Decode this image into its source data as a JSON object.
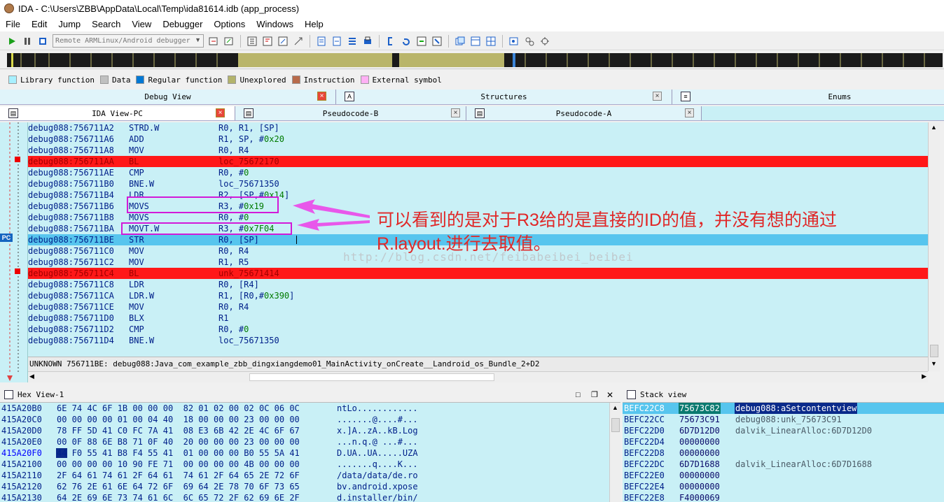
{
  "window": {
    "title": "IDA - C:\\Users\\ZBB\\AppData\\Local\\Temp\\ida81614.idb (app_process)"
  },
  "menu": [
    "File",
    "Edit",
    "Jump",
    "Search",
    "View",
    "Debugger",
    "Options",
    "Windows",
    "Help"
  ],
  "toolbar": {
    "debugger_select": "Remote ARMLinux/Android debugger"
  },
  "legend": [
    {
      "label": "Library function",
      "color": "#a8f0ff"
    },
    {
      "label": "Data",
      "color": "#c0c0c0"
    },
    {
      "label": "Regular function",
      "color": "#0078d4"
    },
    {
      "label": "Unexplored",
      "color": "#b3b36b"
    },
    {
      "label": "Instruction",
      "color": "#b86a4a"
    },
    {
      "label": "External symbol",
      "color": "#ffb0f4"
    }
  ],
  "tabs_top": [
    "Debug View",
    "Structures",
    "Enums"
  ],
  "tabs_sub": [
    "IDA View-PC",
    "Pseudocode-B",
    "Pseudocode-A"
  ],
  "gutter": {
    "pc_label": "PC"
  },
  "code": [
    {
      "addr": "debug088:756711A2",
      "mn": "STRD.W",
      "op": "R0, R1, [SP]"
    },
    {
      "addr": "debug088:756711A6",
      "mn": "ADD",
      "op": "R1, SP, #0x20"
    },
    {
      "addr": "debug088:756711A8",
      "mn": "MOV",
      "op": "R0, R4"
    },
    {
      "addr": "debug088:756711AA",
      "mn": "BL",
      "op": "loc_75672170"
    },
    {
      "addr": "debug088:756711AE",
      "mn": "CMP",
      "op": "R0, #0"
    },
    {
      "addr": "debug088:756711B0",
      "mn": "BNE.W",
      "op": "loc_75671350"
    },
    {
      "addr": "debug088:756711B4",
      "mn": "LDR",
      "op": "R2, [SP,#0x14]"
    },
    {
      "addr": "debug088:756711B6",
      "mn": "MOVS",
      "op": "R3, #0x19"
    },
    {
      "addr": "debug088:756711B8",
      "mn": "MOVS",
      "op": "R0, #0"
    },
    {
      "addr": "debug088:756711BA",
      "mn": "MOVT.W",
      "op": "R3, #0x7F04"
    },
    {
      "addr": "debug088:756711BE",
      "mn": "STR",
      "op": "R0, [SP]"
    },
    {
      "addr": "debug088:756711C0",
      "mn": "MOV",
      "op": "R0, R4"
    },
    {
      "addr": "debug088:756711C2",
      "mn": "MOV",
      "op": "R1, R5"
    },
    {
      "addr": "debug088:756711C4",
      "mn": "BL",
      "op": "unk_75671414"
    },
    {
      "addr": "debug088:756711C8",
      "mn": "LDR",
      "op": "R0, [R4]"
    },
    {
      "addr": "debug088:756711CA",
      "mn": "LDR.W",
      "op": "R1, [R0,#0x390]"
    },
    {
      "addr": "debug088:756711CE",
      "mn": "MOV",
      "op": "R0, R4"
    },
    {
      "addr": "debug088:756711D0",
      "mn": "BLX",
      "op": "R1"
    },
    {
      "addr": "debug088:756711D2",
      "mn": "CMP",
      "op": "R0, #0"
    },
    {
      "addr": "debug088:756711D4",
      "mn": "BNE.W",
      "op": "loc_75671350"
    }
  ],
  "status_line": "UNKNOWN 756711BE: debug088:Java_com_example_zbb_dingxiangdemo01_MainActivity_onCreate__Landroid_os_Bundle_2+D2",
  "annotation": {
    "line1": "可以看到的是对于R3给的是直接的ID的值，并没有想的通过",
    "line2": "R.layout.进行去取值。"
  },
  "watermark": "http://blog.csdn.net/feibabeibei_beibei",
  "hex_view": {
    "title": "Hex View-1",
    "rows": [
      {
        "addr": "415A20B0",
        "bytes": "6E 74 4C 6F 1B 00 00 00  82 01 02 00 02 0C 06 0C",
        "ascii": "ntLo............"
      },
      {
        "addr": "415A20C0",
        "bytes": "00 00 00 00 01 00 04 40  18 00 00 00 23 00 00 00",
        "ascii": ".......@....#..."
      },
      {
        "addr": "415A20D0",
        "bytes": "78 FF 5D 41 C0 FC 7A 41  08 E3 6B 42 2E 4C 6F 67",
        "ascii": "x.]A..zA..kB.Log"
      },
      {
        "addr": "415A20E0",
        "bytes": "00 0F 88 6E B8 71 0F 40  20 00 00 00 23 00 00 00",
        "ascii": "...n.q.@ ...#..."
      },
      {
        "addr": "415A20F0",
        "bytes": "44 F0 55 41 B8 F4 55 41  01 00 00 00 B0 55 5A 41",
        "ascii": "D.UA..UA.....UZA"
      },
      {
        "addr": "415A2100",
        "bytes": "00 00 00 00 10 90 FE 71  00 00 00 00 4B 00 00 00",
        "ascii": ".......q....K..."
      },
      {
        "addr": "415A2110",
        "bytes": "2F 64 61 74 61 2F 64 61  74 61 2F 64 65 2E 72 6F",
        "ascii": "/data/data/de.ro"
      },
      {
        "addr": "415A2120",
        "bytes": "62 76 2E 61 6E 64 72 6F  69 64 2E 78 70 6F 73 65",
        "ascii": "bv.android.xpose"
      },
      {
        "addr": "415A2130",
        "bytes": "64 2E 69 6E 73 74 61 6C  6C 65 72 2F 62 69 6E 2F",
        "ascii": "d.installer/bin/"
      }
    ]
  },
  "stack_view": {
    "title": "Stack view",
    "rows": [
      {
        "addr": "BEFC22C8",
        "val": "75673C82",
        "desc": "debug088:aSetcontentview"
      },
      {
        "addr": "BEFC22CC",
        "val": "75673C91",
        "desc": "debug088:unk_75673C91"
      },
      {
        "addr": "BEFC22D0",
        "val": "6D7D12D0",
        "desc": "dalvik_LinearAlloc:6D7D12D0"
      },
      {
        "addr": "BEFC22D4",
        "val": "00000000",
        "desc": ""
      },
      {
        "addr": "BEFC22D8",
        "val": "00000000",
        "desc": ""
      },
      {
        "addr": "BEFC22DC",
        "val": "6D7D1688",
        "desc": "dalvik_LinearAlloc:6D7D1688"
      },
      {
        "addr": "BEFC22E0",
        "val": "00000000",
        "desc": ""
      },
      {
        "addr": "BEFC22E4",
        "val": "00000000",
        "desc": ""
      },
      {
        "addr": "BEFC22E8",
        "val": "F4000069",
        "desc": ""
      }
    ]
  }
}
